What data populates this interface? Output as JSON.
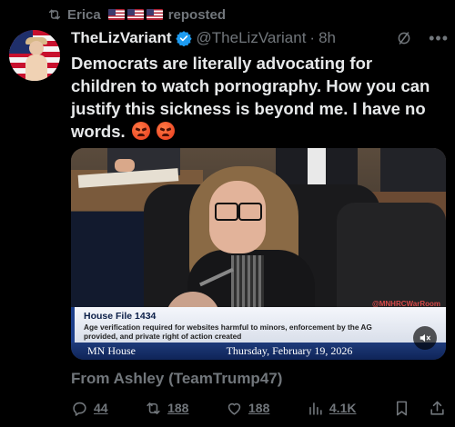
{
  "repost": {
    "user": "Erica",
    "label": "reposted"
  },
  "author": {
    "display_name": "TheLizVariant",
    "handle": "@TheLizVariant",
    "separator": "·",
    "time": "8h"
  },
  "tweet": {
    "text": "Democrats are literally advocating for children to watch pornography. How you can justify this sickness is beyond me. I have no words."
  },
  "media": {
    "watermark": "@MNHRCWarRoom",
    "bill_title": "House File 1434",
    "bill_description": "Age verification required for websites harmful to minors, enforcement by the AG provided, and private right of action created",
    "organization": "MN House",
    "date": "Thursday, February 19, 2026"
  },
  "source_line": "From Ashley (TeamTrump47)",
  "actions": {
    "replies": "44",
    "reposts": "188",
    "likes": "188",
    "views": "4.1K"
  },
  "colors": {
    "background": "#000000",
    "text": "#e7e9ea",
    "muted": "#71767b",
    "verified": "#1d9bf0"
  }
}
